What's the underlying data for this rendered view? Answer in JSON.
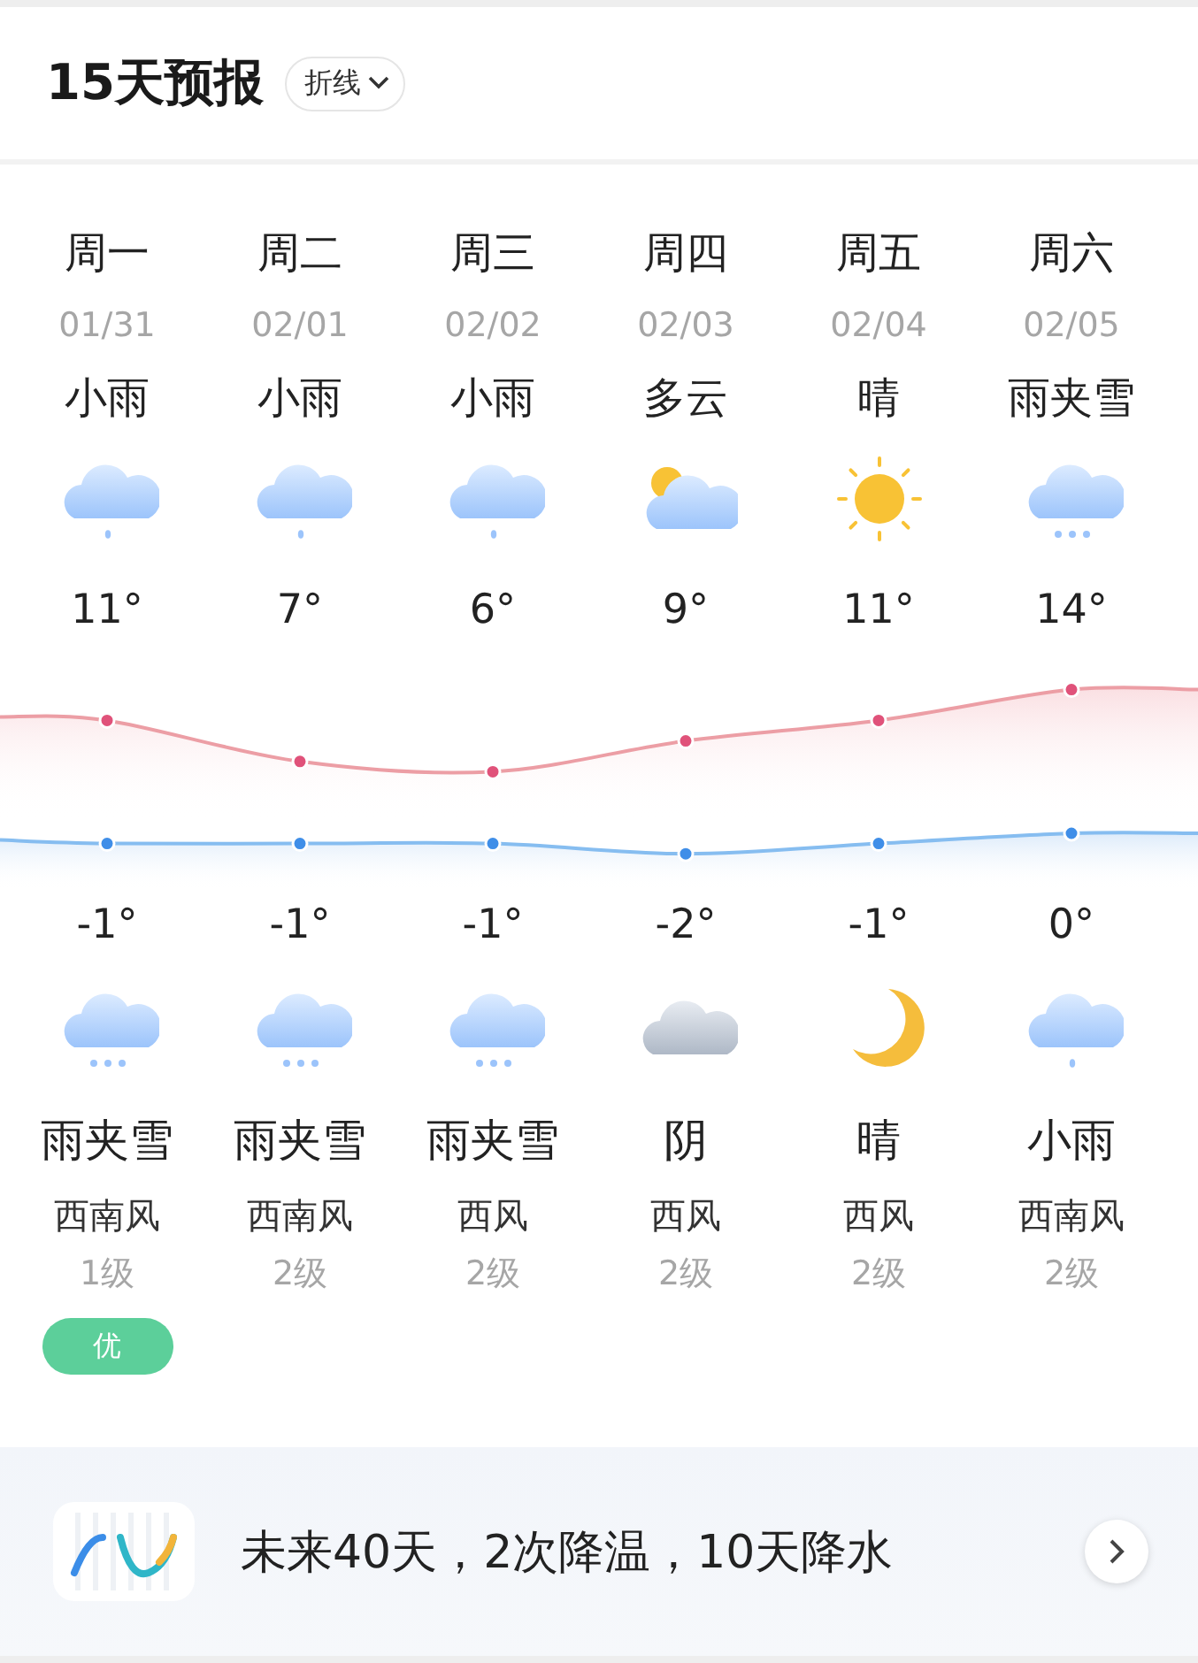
{
  "header": {
    "title": "15天预报",
    "mode_button": {
      "label": "折线"
    }
  },
  "days": [
    {
      "weekday": "周一",
      "date": "01/31",
      "day_condition": "小雨",
      "day_icon": {
        "kind": "rain"
      },
      "high": "11°",
      "low": "-1°",
      "night_icon": {
        "kind": "sleet"
      },
      "night_condition": "雨夹雪",
      "wind": "西南风",
      "wind_level": "1级",
      "air_quality": {
        "label": "优",
        "color": "#5ccf9a"
      }
    },
    {
      "weekday": "周二",
      "date": "02/01",
      "day_condition": "小雨",
      "day_icon": {
        "kind": "rain"
      },
      "high": "7°",
      "low": "-1°",
      "night_icon": {
        "kind": "sleet"
      },
      "night_condition": "雨夹雪",
      "wind": "西南风",
      "wind_level": "2级"
    },
    {
      "weekday": "周三",
      "date": "02/02",
      "day_condition": "小雨",
      "day_icon": {
        "kind": "rain"
      },
      "high": "6°",
      "low": "-1°",
      "night_icon": {
        "kind": "sleet"
      },
      "night_condition": "雨夹雪",
      "wind": "西风",
      "wind_level": "2级"
    },
    {
      "weekday": "周四",
      "date": "02/03",
      "day_condition": "多云",
      "day_icon": {
        "kind": "suncloud"
      },
      "high": "9°",
      "low": "-2°",
      "night_icon": {
        "kind": "overcast"
      },
      "night_condition": "阴",
      "wind": "西风",
      "wind_level": "2级"
    },
    {
      "weekday": "周五",
      "date": "02/04",
      "day_condition": "晴",
      "day_icon": {
        "kind": "sun"
      },
      "high": "11°",
      "low": "-1°",
      "night_icon": {
        "kind": "moon"
      },
      "night_condition": "晴",
      "wind": "西风",
      "wind_level": "2级"
    },
    {
      "weekday": "周六",
      "date": "02/05",
      "day_condition": "雨夹雪",
      "day_icon": {
        "kind": "sleet"
      },
      "high": "14°",
      "low": "0°",
      "night_icon": {
        "kind": "rain"
      },
      "night_condition": "小雨",
      "wind": "西南风",
      "wind_level": "2级"
    }
  ],
  "outlook": {
    "text": "未来40天，2次降温，10天降水"
  }
}
